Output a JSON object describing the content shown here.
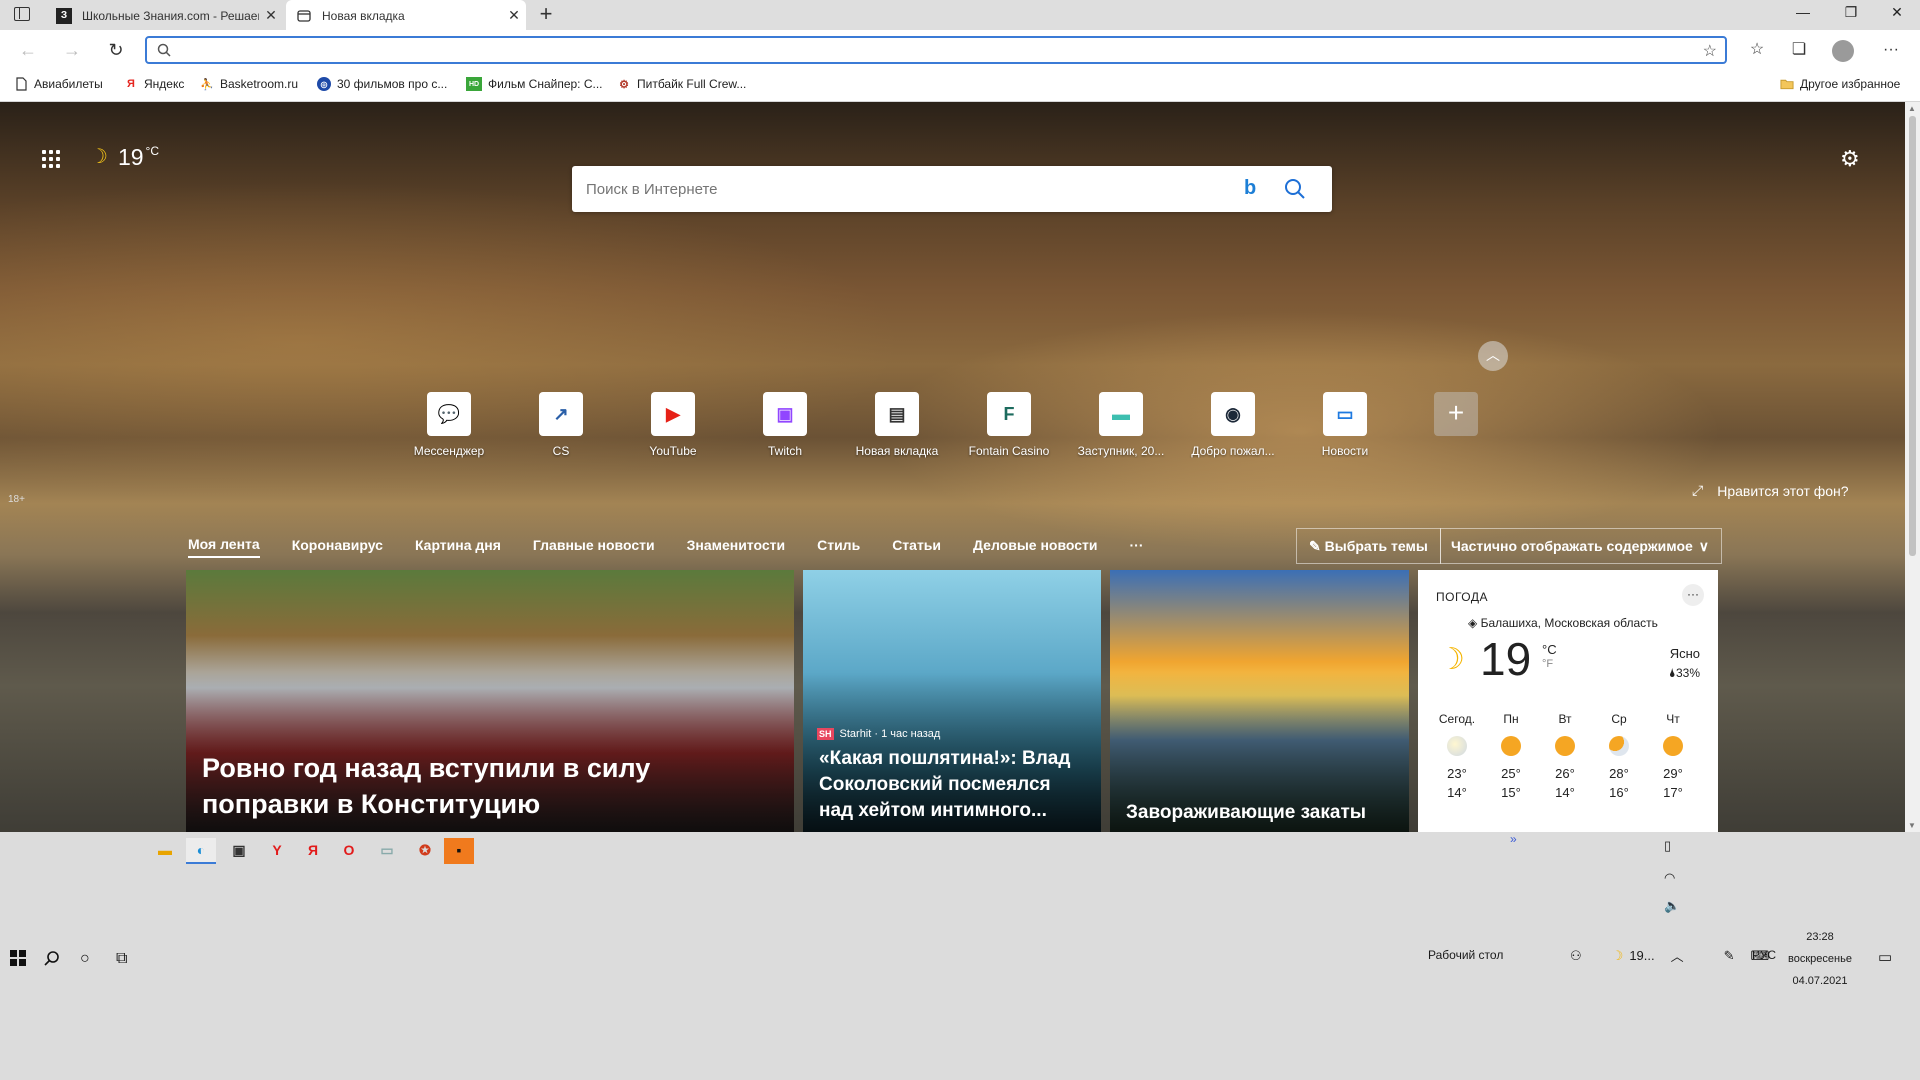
{
  "tabs": [
    {
      "title": "Школьные Знания.com - Решаем",
      "favicon": "З",
      "active": false
    },
    {
      "title": "Новая вкладка",
      "favicon": "newtab-icon",
      "active": true
    }
  ],
  "address": {
    "value": "",
    "placeholder": ""
  },
  "bookmarks": [
    {
      "label": "Авиабилеты",
      "icon": "page-icon"
    },
    {
      "label": "Яндекс",
      "icon": "Я"
    },
    {
      "label": "Basketroom.ru",
      "icon": "player-icon"
    },
    {
      "label": "30 фильмов про с...",
      "icon": "globe-icon"
    },
    {
      "label": "Фильм Снайпер: С...",
      "icon": "HD"
    },
    {
      "label": "Питбайк Full Crew...",
      "icon": "bike-icon"
    }
  ],
  "other_favorites": "Другое избранное",
  "ntp": {
    "weather_top": {
      "temp": "19",
      "unit": "°C"
    },
    "search_placeholder": "Поиск в Интернете",
    "quick_links": [
      {
        "label": "Мессенджер",
        "glyph": "💬",
        "color": "#1f7ae0"
      },
      {
        "label": "CS",
        "glyph": "↗",
        "color": "#2a5fa8"
      },
      {
        "label": "YouTube",
        "glyph": "▶",
        "color": "#e62117"
      },
      {
        "label": "Twitch",
        "glyph": "▣",
        "color": "#9146ff"
      },
      {
        "label": "Новая вкладка",
        "glyph": "▤",
        "color": "#333333"
      },
      {
        "label": "Fontain Casino",
        "glyph": "F",
        "color": "#1c6b5e"
      },
      {
        "label": "Заступник, 20...",
        "glyph": "▬",
        "color": "#3dbfb0"
      },
      {
        "label": "Добро пожал...",
        "glyph": "◉",
        "color": "#1b2838"
      },
      {
        "label": "Новости",
        "glyph": "▭",
        "color": "#1f7ae0"
      }
    ],
    "age": "18+",
    "like_bg": "Нравится этот фон?",
    "feed_nav": [
      "Моя лента",
      "Коронавирус",
      "Картина дня",
      "Главные новости",
      "Знаменитости",
      "Стиль",
      "Статьи",
      "Деловые новости",
      "···"
    ],
    "choose_topics": "Выбрать темы",
    "display_mode": "Частично отображать содержимое",
    "cards": [
      {
        "headline": "Ровно год назад вступили в силу поправки в Конституцию"
      },
      {
        "source": "Starhit · 1 час назад",
        "source_logo": "SH",
        "headline": "«Какая пошлятина!»: Влад Соколовский посмеялся над хейтом интимного..."
      },
      {
        "headline": "Завораживающие закаты"
      }
    ],
    "weather_card": {
      "header": "ПОГОДА",
      "location": "Балашиха, Московская область",
      "temp": "19",
      "unit_c": "°C",
      "unit_f": "°F",
      "condition": "Ясно",
      "humidity": "33%",
      "forecast": [
        {
          "day": "Сегод.",
          "hi": "23°",
          "lo": "14°",
          "icon": "cloud"
        },
        {
          "day": "Пн",
          "hi": "25°",
          "lo": "15°",
          "icon": "sun"
        },
        {
          "day": "Вт",
          "hi": "26°",
          "lo": "14°",
          "icon": "sun"
        },
        {
          "day": "Ср",
          "hi": "28°",
          "lo": "16°",
          "icon": "part"
        },
        {
          "day": "Чт",
          "hi": "29°",
          "lo": "17°",
          "icon": "sun"
        }
      ]
    }
  },
  "taskbar": {
    "desktop_label": "Рабочий стол",
    "tray_weather": "19...",
    "lang": "РУС",
    "time": "23:28",
    "day": "воскресенье",
    "date": "04.07.2021"
  }
}
